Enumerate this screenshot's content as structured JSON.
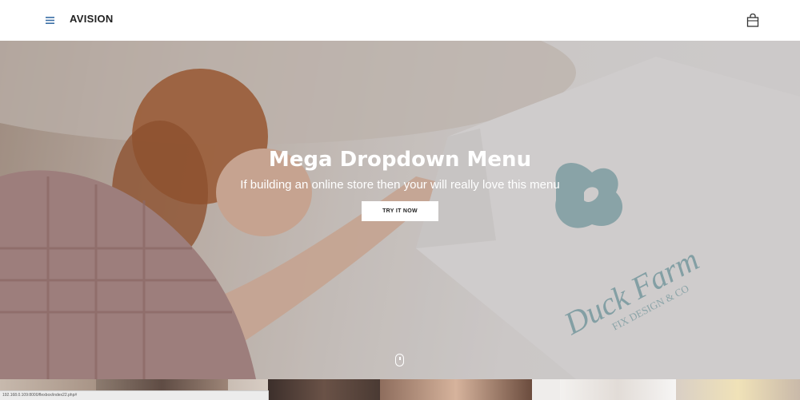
{
  "header": {
    "brand": "AVISION",
    "menu_icon": "hamburger-icon",
    "bag_icon": "shopping-bag-icon"
  },
  "hero": {
    "title": "Mega Dropdown Menu",
    "subtitle": "If building an online store then your will really love this menu",
    "cta_label": "TRY IT NOW",
    "scroll_icon": "mouse-scroll-icon",
    "bag_print_line1": "Duck Farm",
    "bag_print_line2": "FIX DESIGN & CO"
  },
  "status_bar": {
    "url": "192.168.0.109:8000/flexbox/index22.php#"
  },
  "colors": {
    "accent_blue": "#3a6ea5",
    "text_dark": "#222222",
    "bag_print": "#8fb7bd"
  }
}
